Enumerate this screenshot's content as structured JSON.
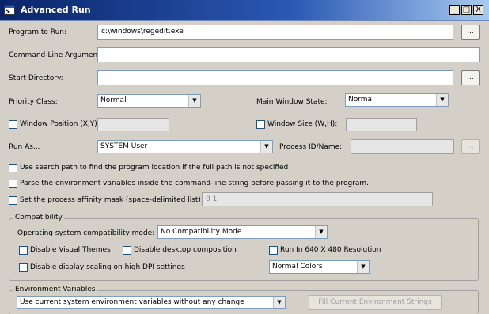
{
  "window": {
    "title": "Advanced Run",
    "minimize": "_",
    "maximize": "□",
    "close": "X"
  },
  "program": {
    "label": "Program to Run:",
    "value": "c:\\windows\\regedit.exe",
    "browse": "..."
  },
  "args": {
    "label": "Command-Line Arguments:",
    "value": ""
  },
  "startdir": {
    "label": "Start Directory:",
    "value": "",
    "browse": "..."
  },
  "priority": {
    "label": "Priority Class:",
    "value": "Normal"
  },
  "mainwindow": {
    "label": "Main Window State:",
    "value": "Normal"
  },
  "winpos": {
    "label": "Window Position (X,Y):",
    "value": ""
  },
  "winsize": {
    "label": "Window Size (W,H):",
    "value": ""
  },
  "runas": {
    "label": "Run As...",
    "value": "SYSTEM User"
  },
  "pid": {
    "label": "Process ID/Name:",
    "value": "",
    "browse": "..."
  },
  "options": {
    "searchpath": "Use search path to find the program location if the full path is not specified",
    "envparse": "Parse the environment variables inside the command-line string before passing it to the program.",
    "affinity": "Set the process affinity mask (space-delimited list):",
    "affinity_value": "0 1"
  },
  "compat": {
    "title": "Compatibility",
    "mode_label": "Operating system compatibility mode:",
    "mode_value": "No Compatibility Mode",
    "disable_themes": "Disable Visual Themes",
    "disable_desktop": "Disable desktop composition",
    "run640": "Run In 640 X 480 Resolution",
    "disable_dpi": "Disable display scaling on high DPI settings",
    "colors": "Normal Colors"
  },
  "env": {
    "title": "Environment Variables",
    "mode": "Use current system environment variables without any change",
    "fill_button": "Fill Current Environment Strings"
  }
}
